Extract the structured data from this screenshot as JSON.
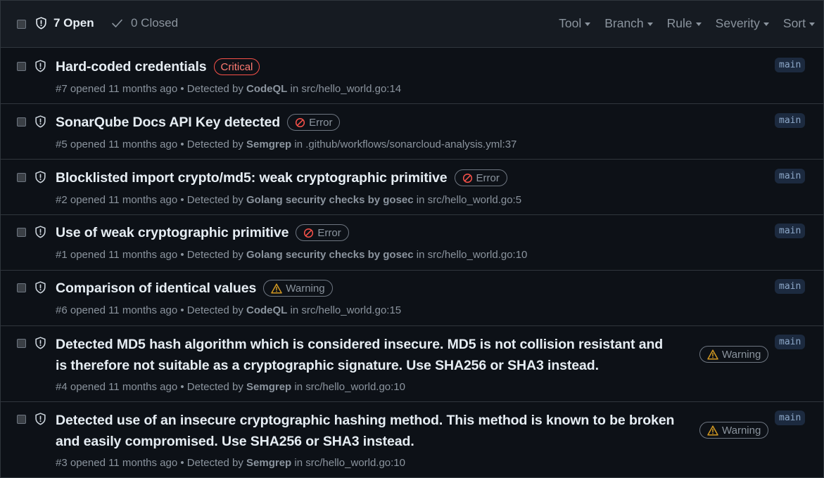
{
  "header": {
    "open_label": "7 Open",
    "closed_label": "0 Closed",
    "filters": [
      "Tool",
      "Branch",
      "Rule",
      "Severity",
      "Sort"
    ]
  },
  "colors": {
    "background": "#0d1117",
    "header_bg": "#161b22",
    "border": "#30363d",
    "critical": "#f85149",
    "error_icon": "#f85149",
    "warning_icon": "#d29922",
    "text_primary": "#e6edf3",
    "text_muted": "#8b949e"
  },
  "alerts": [
    {
      "title": "Hard-coded credentials",
      "severity": "Critical",
      "severity_icon": "none",
      "number": "#7",
      "opened": "opened 11 months ago",
      "detected_by": "Detected by",
      "tool": "CodeQL",
      "in": "in",
      "location": "src/hello_world.go:14",
      "branch": "main"
    },
    {
      "title": "SonarQube Docs API Key detected",
      "severity": "Error",
      "severity_icon": "circle-slash-icon",
      "number": "#5",
      "opened": "opened 11 months ago",
      "detected_by": "Detected by",
      "tool": "Semgrep",
      "in": "in",
      "location": ".github/workflows/sonarcloud-analysis.yml:37",
      "branch": "main"
    },
    {
      "title": "Blocklisted import crypto/md5: weak cryptographic primitive",
      "severity": "Error",
      "severity_icon": "circle-slash-icon",
      "number": "#2",
      "opened": "opened 11 months ago",
      "detected_by": "Detected by",
      "tool": "Golang security checks by gosec",
      "in": "in",
      "location": "src/hello_world.go:5",
      "branch": "main"
    },
    {
      "title": "Use of weak cryptographic primitive",
      "severity": "Error",
      "severity_icon": "circle-slash-icon",
      "number": "#1",
      "opened": "opened 11 months ago",
      "detected_by": "Detected by",
      "tool": "Golang security checks by gosec",
      "in": "in",
      "location": "src/hello_world.go:10",
      "branch": "main"
    },
    {
      "title": "Comparison of identical values",
      "severity": "Warning",
      "severity_icon": "alert-triangle-icon",
      "number": "#6",
      "opened": "opened 11 months ago",
      "detected_by": "Detected by",
      "tool": "CodeQL",
      "in": "in",
      "location": "src/hello_world.go:15",
      "branch": "main"
    },
    {
      "title": "Detected MD5 hash algorithm which is considered insecure. MD5 is not collision resistant and is therefore not suitable as a cryptographic signature. Use SHA256 or SHA3 instead.",
      "severity": "Warning",
      "severity_icon": "alert-triangle-icon",
      "number": "#4",
      "opened": "opened 11 months ago",
      "detected_by": "Detected by",
      "tool": "Semgrep",
      "in": "in",
      "location": "src/hello_world.go:10",
      "branch": "main"
    },
    {
      "title": "Detected use of an insecure cryptographic hashing method. This method is known to be broken and easily compromised. Use SHA256 or SHA3 instead.",
      "severity": "Warning",
      "severity_icon": "alert-triangle-icon",
      "number": "#3",
      "opened": "opened 11 months ago",
      "detected_by": "Detected by",
      "tool": "Semgrep",
      "in": "in",
      "location": "src/hello_world.go:10",
      "branch": "main"
    }
  ]
}
